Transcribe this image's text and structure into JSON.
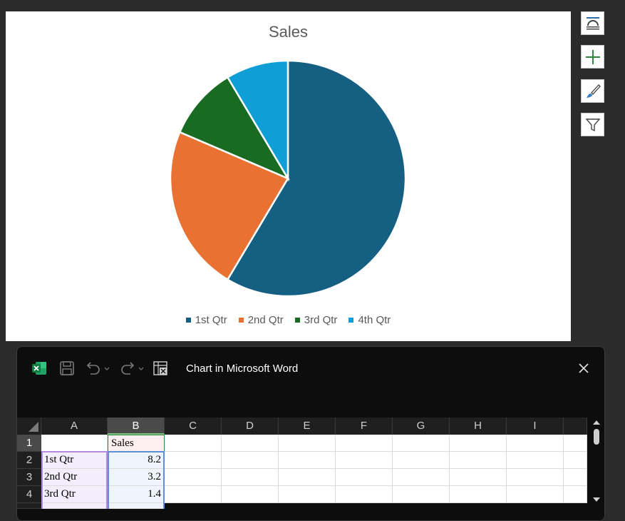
{
  "chart_data": {
    "type": "pie",
    "title": "Sales",
    "categories": [
      "1st Qtr",
      "2nd Qtr",
      "3rd Qtr",
      "4th Qtr"
    ],
    "values": [
      8.2,
      3.2,
      1.4,
      1.2
    ],
    "colors": [
      "#156082",
      "#E97132",
      "#196B24",
      "#0F9ED5"
    ],
    "legend_position": "bottom"
  },
  "side_buttons": [
    {
      "icon": "layout-options-icon"
    },
    {
      "icon": "chart-elements-plus-icon"
    },
    {
      "icon": "chart-styles-brush-icon"
    },
    {
      "icon": "chart-filters-funnel-icon"
    }
  ],
  "window": {
    "title": "Chart in Microsoft Word",
    "icons": [
      "excel-icon",
      "save-icon",
      "undo-icon",
      "redo-icon",
      "edit-data-icon",
      "close-icon"
    ]
  },
  "sheet": {
    "columns": [
      "A",
      "B",
      "C",
      "D",
      "E",
      "F",
      "G",
      "H",
      "I"
    ],
    "row_numbers": [
      "1",
      "2",
      "3",
      "4"
    ],
    "rows": [
      [
        "",
        "Sales"
      ],
      [
        "1st Qtr",
        "8.2"
      ],
      [
        "2nd Qtr",
        "3.2"
      ],
      [
        "3rd Qtr",
        "1.4"
      ]
    ]
  }
}
